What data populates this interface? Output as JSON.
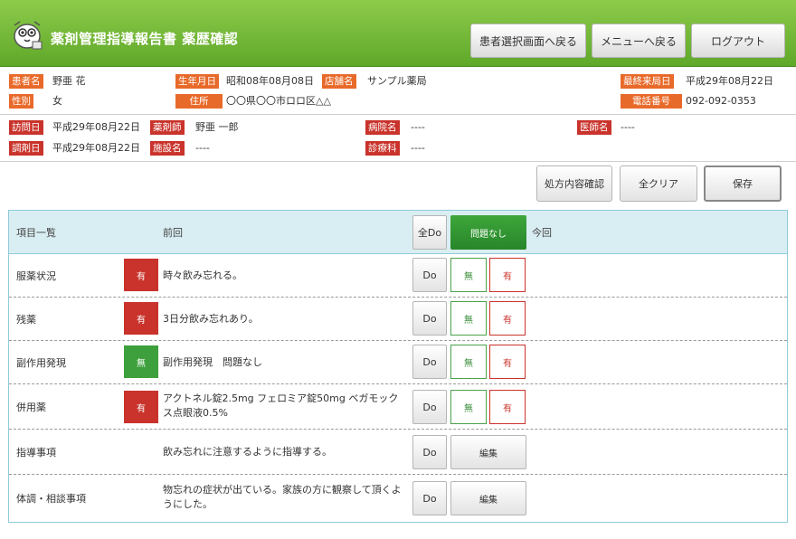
{
  "header": {
    "title": "薬剤管理指導報告書 薬歴確認",
    "buttons": {
      "back_patient": "患者選択画面へ戻る",
      "back_menu": "メニューへ戻る",
      "logout": "ログアウト"
    }
  },
  "patient": {
    "name_label": "患者名",
    "name": "野亜 花",
    "birth_label": "生年月日",
    "birth": "昭和08年08月08日",
    "store_label": "店舗名",
    "store": "サンプル薬局",
    "last_visit_label": "最終来局日",
    "last_visit": "平成29年08月22日",
    "sex_label": "性別",
    "sex": "女",
    "address_label": "住所",
    "address": "〇〇県〇〇市ロロ区△△",
    "phone_label": "電話番号",
    "phone": "092-092-0353"
  },
  "visit": {
    "visit_date_label": "訪問日",
    "visit_date": "平成29年08月22日",
    "pharmacist_label": "薬剤師",
    "pharmacist": "野亜 一郎",
    "hospital_label": "病院名",
    "hospital": "----",
    "doctor_label": "医師名",
    "doctor": "----",
    "dispense_date_label": "調剤日",
    "dispense_date": "平成29年08月22日",
    "facility_label": "施設名",
    "facility": "----",
    "department_label": "診療科",
    "department": "----"
  },
  "actions": {
    "prescription_check": "処方内容確認",
    "clear_all": "全クリア",
    "save": "保存"
  },
  "table": {
    "head": {
      "items": "項目一覧",
      "previous": "前回",
      "all_do": "全Do",
      "no_problem": "問題なし",
      "current": "今回"
    },
    "rows": [
      {
        "item": "服薬状況",
        "badge": "有",
        "prev": "時々飲み忘れる。",
        "do": "Do",
        "none": "無",
        "exists": "有"
      },
      {
        "item": "残薬",
        "badge": "有",
        "prev": "3日分飲み忘れあり。",
        "do": "Do",
        "none": "無",
        "exists": "有"
      },
      {
        "item": "副作用発現",
        "badge": "無",
        "prev": "副作用発現　問題なし",
        "do": "Do",
        "none": "無",
        "exists": "有"
      },
      {
        "item": "併用薬",
        "badge": "有",
        "prev": "アクトネル錠2.5mg フェロミア錠50mg ベガモックス点眼液0.5%",
        "do": "Do",
        "none": "無",
        "exists": "有"
      },
      {
        "item": "指導事項",
        "prev": "飲み忘れに注意するように指導する。",
        "do": "Do",
        "edit": "編集"
      },
      {
        "item": "体調・相談事項",
        "prev": "物忘れの症状が出ている。家族の方に観察して頂くようにした。",
        "do": "Do",
        "edit": "編集"
      }
    ]
  },
  "colors": {
    "header_green": "#6fb534",
    "label_orange": "#e86a2a",
    "label_red": "#c9332b",
    "badge_red": "#c9332b",
    "badge_green": "#3ea03c",
    "table_border": "#8fcbd8"
  }
}
